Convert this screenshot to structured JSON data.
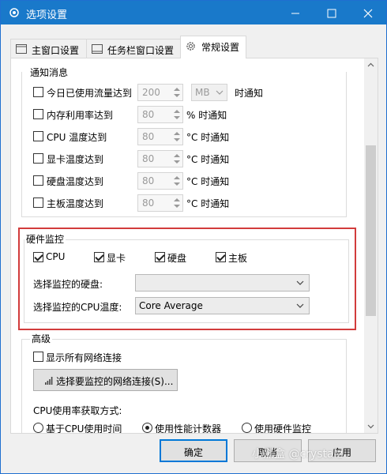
{
  "window": {
    "title": "选项设置"
  },
  "tabs": [
    {
      "label": "主窗口设置",
      "icon": "window-icon"
    },
    {
      "label": "任务栏窗口设置",
      "icon": "taskbar-icon"
    },
    {
      "label": "常规设置",
      "icon": "gear-icon"
    }
  ],
  "notify": {
    "title": "通知消息",
    "rows": [
      {
        "label": "今日已使用流量达到",
        "value": "200",
        "suffix": "时通知",
        "unit": "MB"
      },
      {
        "label": "内存利用率达到",
        "value": "80",
        "suffix": "% 时通知"
      },
      {
        "label": "CPU 温度达到",
        "value": "80",
        "suffix": "°C 时通知"
      },
      {
        "label": "显卡温度达到",
        "value": "80",
        "suffix": "°C 时通知"
      },
      {
        "label": "硬盘温度达到",
        "value": "80",
        "suffix": "°C 时通知"
      },
      {
        "label": "主板温度达到",
        "value": "80",
        "suffix": "°C 时通知"
      }
    ]
  },
  "hardware": {
    "title": "硬件监控",
    "checks": [
      {
        "label": "CPU",
        "checked": true
      },
      {
        "label": "显卡",
        "checked": true
      },
      {
        "label": "硬盘",
        "checked": true
      },
      {
        "label": "主板",
        "checked": true
      }
    ],
    "disk_label": "选择监控的硬盘:",
    "disk_value": "",
    "cpu_temp_label": "选择监控的CPU温度:",
    "cpu_temp_value": "Core Average"
  },
  "advanced": {
    "title": "高级",
    "show_all_label": "显示所有网络连接",
    "select_conn_button": "选择要监控的网络连接(S)...",
    "cpu_usage_title": "CPU使用率获取方式:",
    "radios": [
      {
        "label": "基于CPU使用时间",
        "checked": false
      },
      {
        "label": "使用性能计数器",
        "checked": true
      },
      {
        "label": "使用硬件监控",
        "checked": false
      }
    ]
  },
  "buttons": {
    "ok": "确定",
    "cancel": "取消",
    "apply": "应用"
  },
  "watermark": "小黑盒 @crystalz",
  "colors": {
    "titlebar": "#1979ca",
    "highlight_border": "#d23c3c",
    "default_button_border": "#0078d7"
  }
}
